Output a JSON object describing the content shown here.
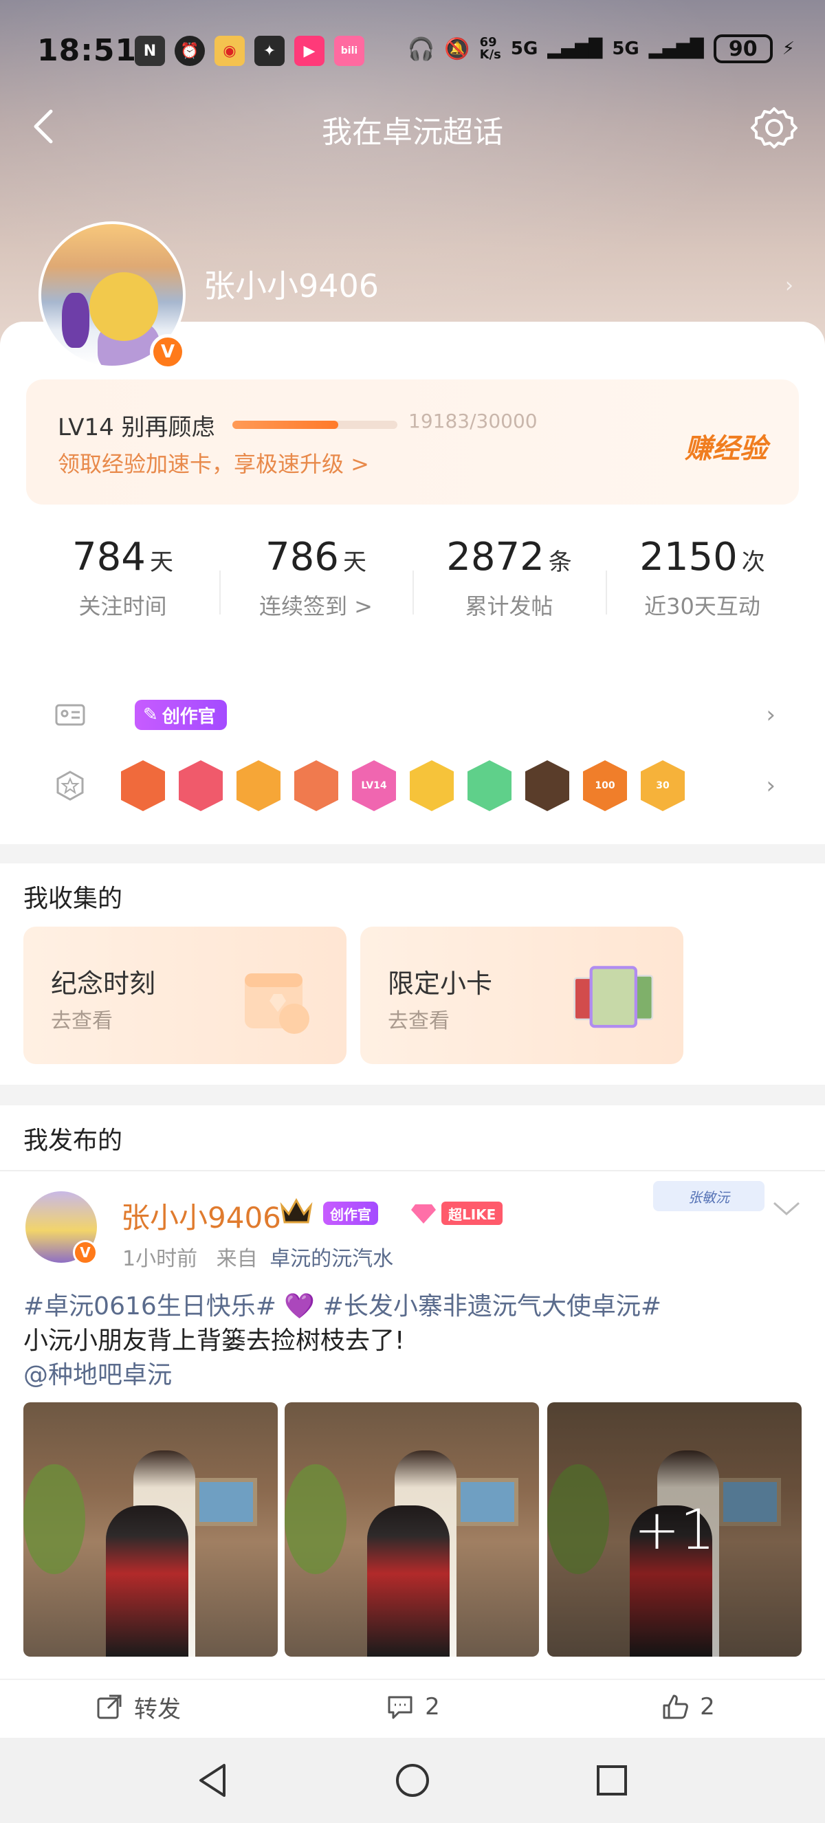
{
  "status_bar": {
    "time": "18:51",
    "network_speed": "69\nK/s",
    "signal_1": "5G",
    "signal_2": "5G",
    "battery": "90"
  },
  "nav": {
    "title": "我在卓沅超话"
  },
  "profile": {
    "username": "张小小9406",
    "verified_badge": "V"
  },
  "level": {
    "label": "LV14 别再顾虑",
    "progress": 0.64,
    "exp_text": "19183/30000",
    "promo": "领取经验加速卡，享极速升级 >",
    "earn_button": "赚经验"
  },
  "stats": [
    {
      "num": "784",
      "unit": "天",
      "label": "关注时间"
    },
    {
      "num": "786",
      "unit": "天",
      "label": "连续签到 >"
    },
    {
      "num": "2872",
      "unit": "条",
      "label": "累计发帖"
    },
    {
      "num": "2150",
      "unit": "次",
      "label": "近30天互动"
    }
  ],
  "badges": {
    "creator_tag": "创作官",
    "medals": [
      {
        "color": "#f06a3c",
        "text": ""
      },
      {
        "color": "#f05a6b",
        "text": ""
      },
      {
        "color": "#f6a637",
        "text": ""
      },
      {
        "color": "#f07a4e",
        "text": ""
      },
      {
        "color": "#f066b0",
        "text": "LV14"
      },
      {
        "color": "#f6c33a",
        "text": ""
      },
      {
        "color": "#5fd08a",
        "text": ""
      },
      {
        "color": "#5a3d2a",
        "text": ""
      },
      {
        "color": "#f07e2a",
        "text": "100"
      },
      {
        "color": "#f6b23a",
        "text": "30"
      }
    ]
  },
  "collection": {
    "title": "我收集的",
    "cards": [
      {
        "title": "纪念时刻",
        "sub": "去查看"
      },
      {
        "title": "限定小卡",
        "sub": "去查看"
      }
    ]
  },
  "posts": {
    "title": "我发布的",
    "item": {
      "author": "张小小9406",
      "creator_tag": "创作官",
      "super_like": "超LIKE",
      "time": "1小时前",
      "from_label": "来自",
      "source": "卓沅的沅汽水",
      "signature": "张敏沅",
      "hashtags_line": "#卓沅0616生日快乐# 💜 #长发小寨非遗沅气大使卓沅#",
      "text": "小沅小朋友背上背篓去捡树枝去了!",
      "mention": "@种地吧卓沅",
      "more_photos": "+1",
      "repost_label": "转发",
      "comment_count": "2",
      "like_count": "2"
    }
  }
}
